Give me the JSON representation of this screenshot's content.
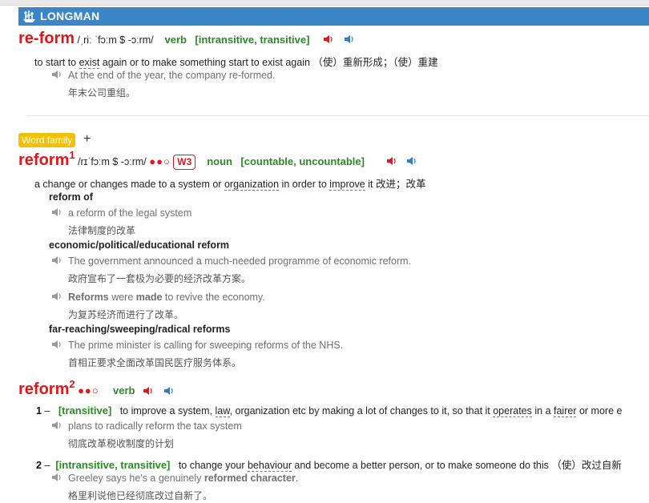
{
  "brand": "LONGMAN",
  "entry1": {
    "headword": "re-form",
    "pron": "/ˌriː ˈfɔːm $ -ɔːrm/",
    "pos": "verb",
    "grammar": "[intransitive, transitive]",
    "def_pre": "to start to ",
    "def_link": "exist",
    "def_post": " again or to make something start to exist again （使）重新形成；（使）重建",
    "example": "At the end of the year, the company re-formed.",
    "example_zh": "年末公司重组。"
  },
  "word_family": {
    "label": "Word family",
    "plus": "+"
  },
  "entry2": {
    "headword": "reform",
    "homnum": "1",
    "pron": "/rɪˈfɔːm $ -ɔːrm/",
    "dots": "●●○",
    "freq": "W3",
    "pos": "noun",
    "grammar": "[countable, uncountable]",
    "def": {
      "a": "a change or changes made to a system or ",
      "b": "organization",
      "c": " in order to ",
      "d": "improve",
      "e": " it 改进；改革"
    },
    "groups": [
      {
        "colloc": "reform of",
        "ex": "a reform of the legal system",
        "zh": "法律制度的改革"
      },
      {
        "colloc": "economic/political/educational reform",
        "ex": "The government announced a much-needed programme of economic reform.",
        "zh": "政府宣布了一套极为必要的经济改革方案。"
      },
      {
        "ex_b1": "Reforms",
        "ex_m1": " were ",
        "ex_b2": "made",
        "ex_t": " to revive the economy.",
        "zh": "为复苏经济而进行了改革。"
      },
      {
        "colloc": "far-reaching/sweeping/radical reforms",
        "ex": "The prime minister is calling for sweeping reforms of the NHS.",
        "zh": "首相正要求全面改革国民医疗服务体系。"
      }
    ]
  },
  "entry3": {
    "headword": "reform",
    "homnum": "2",
    "dots": "●●○",
    "pos": "verb",
    "senses": [
      {
        "num": "1",
        "dash": "–",
        "grammar": "[transitive]",
        "d1": "to improve a system, ",
        "d2": "law",
        "d3": ", organization etc by making a lot of changes to it, so that it ",
        "d4": "operates",
        "d5": " in a ",
        "d6": "fairer",
        "d7": " or more e",
        "ex": "plans to radically reform the tax system",
        "zh": "彻底改革税收制度的计划"
      },
      {
        "num": "2",
        "dash": "–",
        "grammar": "[intransitive, transitive]",
        "d1": "to change your ",
        "d2": "behaviour",
        "d3": " and become a better person, or to make someone do this （使）改过自新",
        "ex1": "Greeley says he's a genuinely ",
        "exb": "reformed character",
        "ex2": ".",
        "zh": "格里利说他已经彻底改过自新了。"
      }
    ]
  },
  "colors": {
    "headword": "#e0171b",
    "pos": "#2a8a23",
    "brand": "#3d86c6",
    "wordfamily": "#f2c200"
  },
  "icons": [
    "ship-logo-icon",
    "speaker-red-icon",
    "speaker-blue-icon",
    "speaker-gray-icon"
  ]
}
